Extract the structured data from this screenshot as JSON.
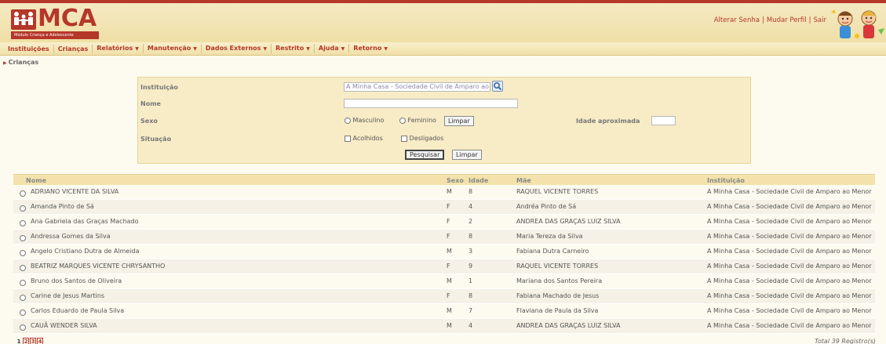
{
  "app": {
    "logo_text": "MCA",
    "logo_subtitle": "Módulo Criança e Adolescente",
    "colors": {
      "brand": "#b5372a",
      "header_bg": "#f0dfa6",
      "panel_bg": "#f8ecc6"
    }
  },
  "top_links": [
    "Alterar Senha",
    "Mudar Perfil",
    "Sair"
  ],
  "menu": [
    {
      "label": "Instituições",
      "dropdown": false
    },
    {
      "label": "Crianças",
      "dropdown": false
    },
    {
      "label": "Relatórios",
      "dropdown": true
    },
    {
      "label": "Manutenção",
      "dropdown": true
    },
    {
      "label": "Dados Externos",
      "dropdown": true
    },
    {
      "label": "Restrito",
      "dropdown": true
    },
    {
      "label": "Ajuda",
      "dropdown": true
    },
    {
      "label": "Retorno",
      "dropdown": true
    }
  ],
  "breadcrumb": "Crianças",
  "search": {
    "instituicao_label": "Instituição",
    "instituicao_value": "A Minha Casa - Sociedade Civil de Amparo ao",
    "nome_label": "Nome",
    "nome_value": "",
    "sexo_label": "Sexo",
    "sexo_options": [
      "Masculino",
      "Feminino"
    ],
    "limpar_sexo": "Limpar",
    "idade_label": "Idade aproximada",
    "idade_value": "",
    "situacao_label": "Situação",
    "situacao_options": [
      "Acolhidos",
      "Desligados"
    ],
    "pesquisar_button": "Pesquisar",
    "limpar_button": "Limpar"
  },
  "table": {
    "columns": [
      "Nome",
      "Sexo",
      "Idade",
      "Mãe",
      "Instituição"
    ],
    "rows": [
      [
        "ADRIANO VICENTE DA SILVA",
        "M",
        "8",
        "RAQUEL VICENTE TORRES",
        "A Minha Casa - Sociedade Civil de Amparo ao Menor"
      ],
      [
        "Amanda Pinto de Sá",
        "F",
        "4",
        "Andréa Pinto de Sá",
        "A Minha Casa - Sociedade Civil de Amparo ao Menor"
      ],
      [
        "Ana Gabriela das Graças Machado",
        "F",
        "2",
        "ANDREA DAS GRAÇAS LUIZ SILVA",
        "A Minha Casa - Sociedade Civil de Amparo ao Menor"
      ],
      [
        "Andressa Gomes da Silva",
        "F",
        "8",
        "Maria Tereza da Silva",
        "A Minha Casa - Sociedade Civil de Amparo ao Menor"
      ],
      [
        "Angelo Cristiano Dutra de Almeida",
        "M",
        "3",
        "Fabiana Dutra Carneiro",
        "A Minha Casa - Sociedade Civil de Amparo ao Menor"
      ],
      [
        "BEATRIZ MARQUES VICENTE CHRYSANTHO",
        "F",
        "9",
        "RAQUEL VICENTE TORRES",
        "A Minha Casa - Sociedade Civil de Amparo ao Menor"
      ],
      [
        "Bruno dos Santos de Oliveira",
        "M",
        "1",
        "Mariana dos Santos Pereira",
        "A Minha Casa - Sociedade Civil de Amparo ao Menor"
      ],
      [
        "Carine de Jesus Martins",
        "F",
        "8",
        "Fabiana Machado de Jesus",
        "A Minha Casa - Sociedade Civil de Amparo ao Menor"
      ],
      [
        "Carlos Eduardo de Paula Silva",
        "M",
        "7",
        "Flaviana de Paula da Silva",
        "A Minha Casa - Sociedade Civil de Amparo ao Menor"
      ],
      [
        "CAUÃ WENDER SILVA",
        "M",
        "4",
        "ANDREA DAS GRAÇAS LUIZ SILVA",
        "A Minha Casa - Sociedade Civil de Amparo ao Menor"
      ]
    ]
  },
  "pagination": {
    "pages": [
      "1",
      "2",
      "3",
      "4"
    ],
    "current": "1"
  },
  "total_text": "Total 39 Registro(s)"
}
